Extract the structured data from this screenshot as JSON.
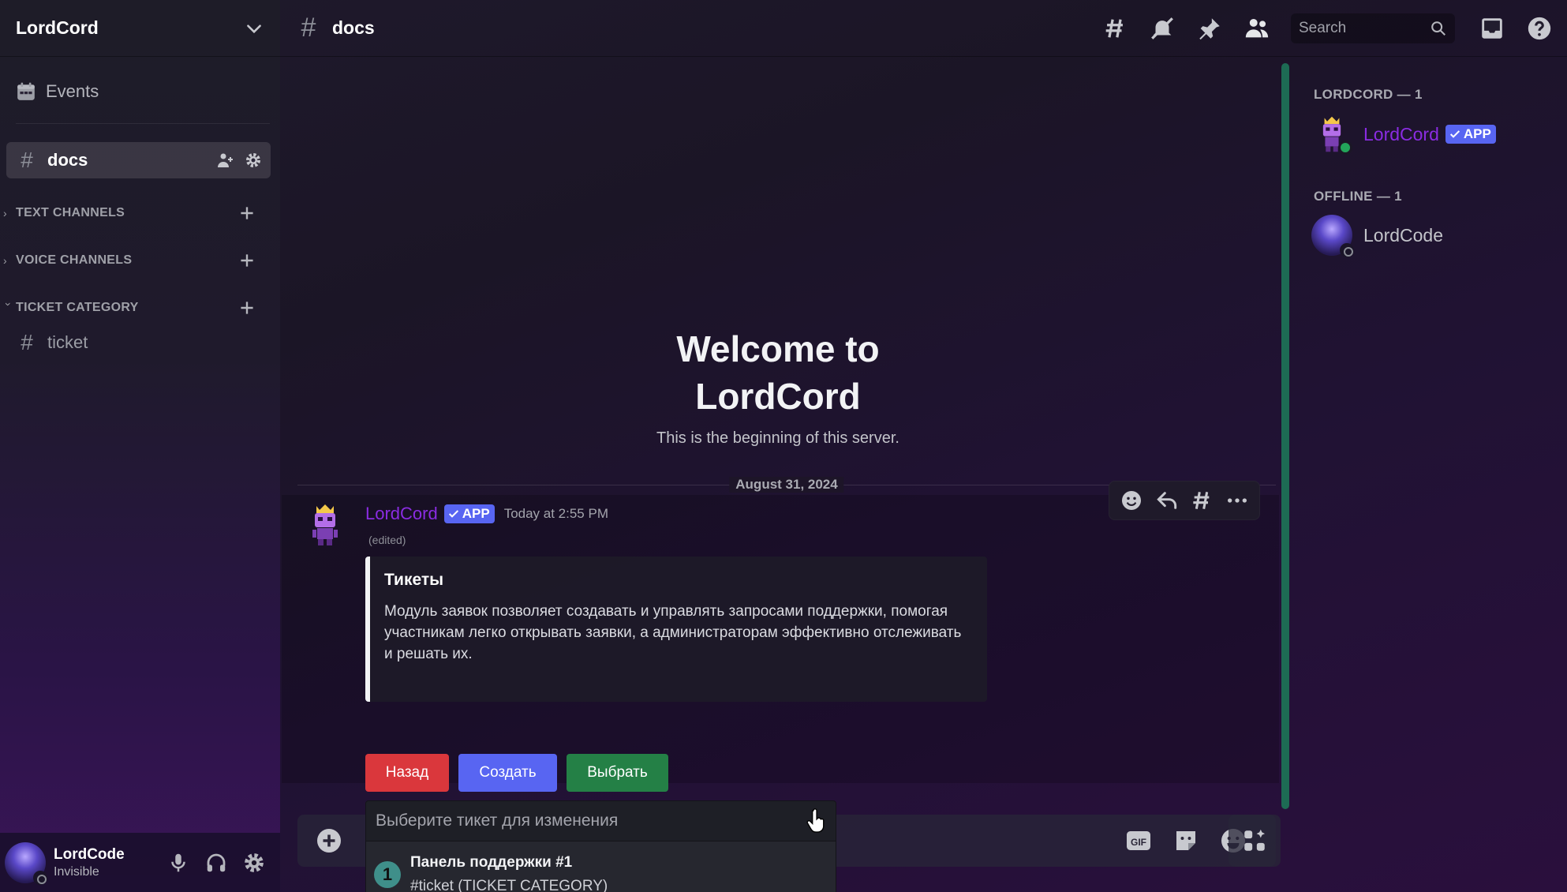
{
  "server": {
    "name": "LordCord"
  },
  "sidebar": {
    "events_label": "Events",
    "active_channel": "docs",
    "categories": [
      {
        "label": "TEXT CHANNELS",
        "collapsed": true
      },
      {
        "label": "VOICE CHANNELS",
        "collapsed": true
      },
      {
        "label": "TICKET CATEGORY",
        "collapsed": false
      }
    ],
    "ticket_channel": "ticket"
  },
  "user_panel": {
    "name": "LordCode",
    "status": "Invisible"
  },
  "header": {
    "channel": "docs",
    "search_placeholder": "Search"
  },
  "welcome": {
    "title_line1": "Welcome to",
    "title_line2": "LordCord",
    "subtitle": "This is the beginning of this server."
  },
  "date_divider": "August 31, 2024",
  "message": {
    "author": "LordCord",
    "badge": "APP",
    "timestamp": "Today at 2:55 PM",
    "edited": "(edited)",
    "embed_title": "Тикеты",
    "embed_description": "Модуль заявок позволяет создавать и управлять запросами поддержки, помогая участникам легко открывать заявки, а администраторам эффективно отслеживать и решать их.",
    "buttons": [
      "Назад",
      "Создать",
      "Выбрать"
    ],
    "select_placeholder": "Выберите тикет для изменения",
    "option": {
      "number": "1",
      "label": "Панель поддержки #1",
      "description": "#ticket (TICKET CATEGORY)"
    }
  },
  "composer": {
    "gif_label": "GIF"
  },
  "members": {
    "online_header": "LORDCORD — 1",
    "offline_header": "OFFLINE — 1",
    "online": [
      {
        "name": "LordCord",
        "badge": "APP"
      }
    ],
    "offline": [
      {
        "name": "LordCode"
      }
    ]
  },
  "colors": {
    "accent": "#5865f2",
    "bot_name": "#8a2ce2",
    "danger": "#da373c",
    "success": "#248046",
    "online": "#23a55a"
  }
}
